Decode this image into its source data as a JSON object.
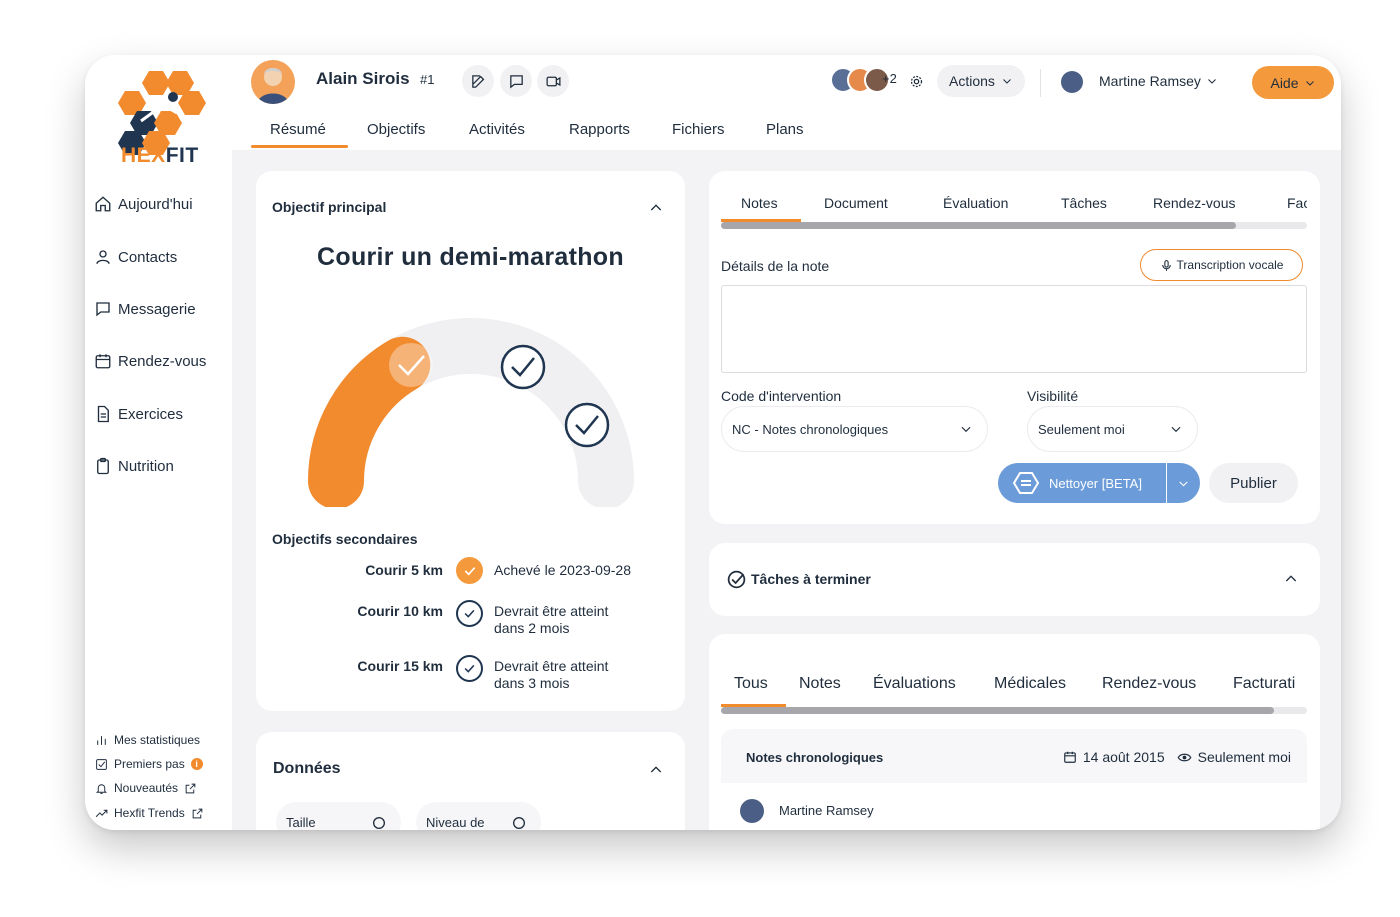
{
  "brand": {
    "name_part1": "HEX",
    "name_part2": "FIT",
    "orange": "#f28a2e",
    "navy": "#1f3550"
  },
  "sidebar": {
    "items": [
      {
        "label": "Aujourd'hui",
        "icon": "home-icon"
      },
      {
        "label": "Contacts",
        "icon": "user-icon"
      },
      {
        "label": "Messagerie",
        "icon": "message-icon"
      },
      {
        "label": "Rendez-vous",
        "icon": "calendar-icon"
      },
      {
        "label": "Exercices",
        "icon": "document-icon"
      },
      {
        "label": "Nutrition",
        "icon": "clipboard-icon"
      }
    ],
    "footer_links": [
      {
        "label": "Mes statistiques",
        "icon": "bar-chart-icon"
      },
      {
        "label": "Premiers pas",
        "icon": "checkbox-icon",
        "badge": "i"
      },
      {
        "label": "Nouveautés",
        "icon": "bell-icon"
      },
      {
        "label": "Hexfit Trends",
        "icon": "trend-icon"
      }
    ]
  },
  "header": {
    "client_name": "Alain Sirois",
    "client_number": "#1",
    "team_extra": "+2",
    "actions_label": "Actions",
    "user_name": "Martine Ramsey",
    "help_label": "Aide",
    "tabs": [
      "Résumé",
      "Objectifs",
      "Activités",
      "Rapports",
      "Fichiers",
      "Plans"
    ],
    "active_tab": 0
  },
  "goal_card": {
    "heading": "Objectif principal",
    "main_goal": "Courir un demi-marathon",
    "progress_fraction": 0.33,
    "secondary_heading": "Objectifs secondaires",
    "secondary": [
      {
        "name": "Courir 5 km",
        "status_line1": "Achevé le 2023-09-28",
        "status_line2": "",
        "done": true
      },
      {
        "name": "Courir 10 km",
        "status_line1": "Devrait être atteint",
        "status_line2": "dans 2 mois",
        "done": false
      },
      {
        "name": "Courir 15 km",
        "status_line1": "Devrait être atteint",
        "status_line2": "dans 3 mois",
        "done": false
      }
    ]
  },
  "data_card": {
    "heading": "Données",
    "fields": [
      "Taille",
      "Niveau de"
    ]
  },
  "notes_card": {
    "tabs": [
      "Notes",
      "Document",
      "Évaluation",
      "Tâches",
      "Rendez-vous",
      "Fac"
    ],
    "note_label": "Détails de la note",
    "voice_button": "Transcription vocale",
    "note_value": "",
    "code_label": "Code d'intervention",
    "code_value": "NC - Notes chronologiques",
    "visibility_label": "Visibilité",
    "visibility_value": "Seulement moi",
    "clean_button": "Nettoyer [BETA]",
    "publish_button": "Publier"
  },
  "tasks_card": {
    "heading": "Tâches à terminer"
  },
  "history_card": {
    "tabs": [
      "Tous",
      "Notes",
      "Évaluations",
      "Médicales",
      "Rendez-vous",
      "Facturati"
    ],
    "entry_title": "Notes chronologiques",
    "entry_date": "14 août 2015",
    "entry_visibility": "Seulement moi",
    "entry_author": "Martine Ramsey"
  }
}
